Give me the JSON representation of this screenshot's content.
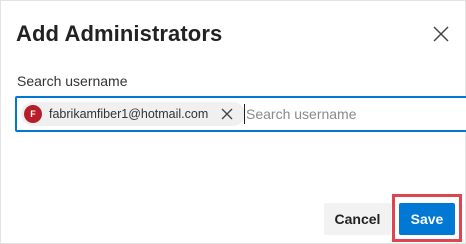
{
  "dialog": {
    "title": "Add Administrators",
    "close_icon": "close-icon"
  },
  "search": {
    "label": "Search username",
    "placeholder": "Search username",
    "value": ""
  },
  "selected_users": [
    {
      "initial": "F",
      "email": "fabrikamfiber1@hotmail.com",
      "avatar_color": "#b51e2a",
      "remove_icon": "close-icon"
    }
  ],
  "footer": {
    "cancel_label": "Cancel",
    "save_label": "Save"
  },
  "colors": {
    "accent": "#0078d4",
    "highlight": "#e0444f",
    "chip_background": "#f0f0f0"
  }
}
